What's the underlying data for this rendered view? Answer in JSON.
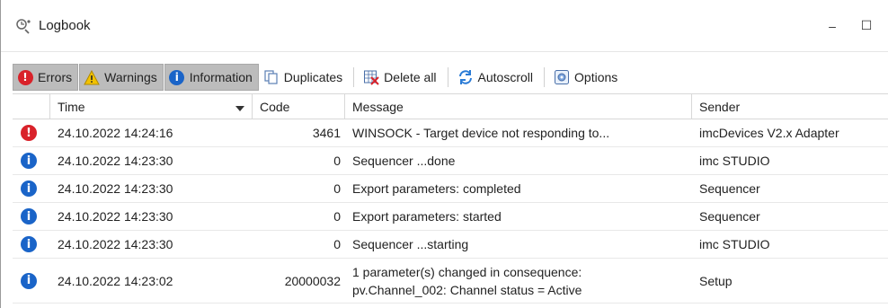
{
  "window": {
    "title": "Logbook",
    "minimize": "–",
    "maximize": "☐"
  },
  "toolbar": {
    "errors": "Errors",
    "warnings": "Warnings",
    "information": "Information",
    "duplicates": "Duplicates",
    "delete_all": "Delete all",
    "autoscroll": "Autoscroll",
    "options": "Options"
  },
  "columns": {
    "time": "Time",
    "code": "Code",
    "message": "Message",
    "sender": "Sender"
  },
  "colors": {
    "error": "#d9222a",
    "info": "#1a64c8",
    "warning": "#f2c200",
    "toggle_bg": "#bcbcbc"
  },
  "rows": [
    {
      "level": "error",
      "time": "24.10.2022 14:24:16",
      "code": "3461",
      "message": "WINSOCK - Target device not responding to...",
      "sender": "imcDevices V2.x Adapter"
    },
    {
      "level": "info",
      "time": "24.10.2022 14:23:30",
      "code": "0",
      "message": "Sequencer ...done",
      "sender": "imc STUDIO"
    },
    {
      "level": "info",
      "time": "24.10.2022 14:23:30",
      "code": "0",
      "message": "Export parameters: completed",
      "sender": "Sequencer"
    },
    {
      "level": "info",
      "time": "24.10.2022 14:23:30",
      "code": "0",
      "message": "Export parameters: started",
      "sender": "Sequencer"
    },
    {
      "level": "info",
      "time": "24.10.2022 14:23:30",
      "code": "0",
      "message": "Sequencer ...starting",
      "sender": "imc STUDIO"
    },
    {
      "level": "info",
      "time": "24.10.2022 14:23:02",
      "code": "20000032",
      "message_line1": "1 parameter(s) changed in consequence:",
      "message_line2": "pv.Channel_002: Channel status = Active",
      "sender": "Setup"
    }
  ]
}
